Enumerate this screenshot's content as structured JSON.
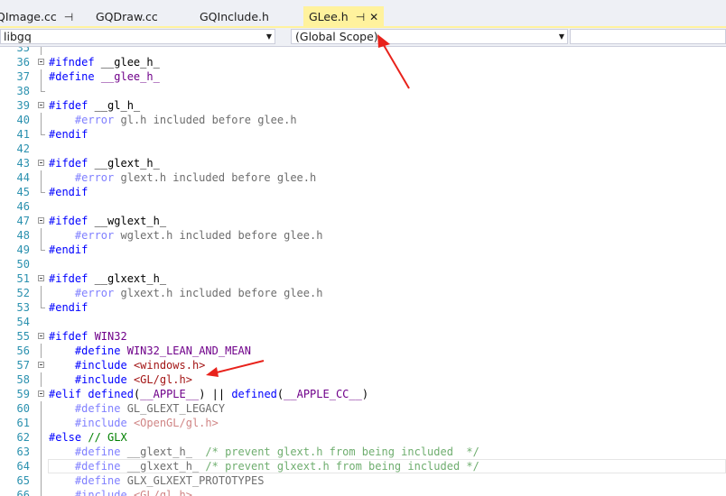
{
  "tabs": [
    {
      "label": "QImage.cc",
      "pinned": true,
      "active": false
    },
    {
      "label": "GQDraw.cc",
      "pinned": false,
      "active": false
    },
    {
      "label": "GQInclude.h",
      "pinned": false,
      "active": false
    },
    {
      "label": "GLee.h",
      "pinned": true,
      "active": true
    }
  ],
  "nav": {
    "project": "libgq",
    "scope": "(Global Scope)",
    "member": ""
  },
  "colors": {
    "active_tab": "#fff29d",
    "line_number": "#2b91af",
    "keyword": "#0000ff",
    "macro": "#6f008a",
    "string": "#a31515",
    "comment": "#008000",
    "annotation_arrow": "#e8221b"
  },
  "icons": {
    "pin": "pin-icon",
    "close": "close-icon",
    "dropdown": "chevron-down-icon",
    "fold": "collapse-box-icon"
  },
  "editor": {
    "lines": [
      {
        "n": "35",
        "fold": "line",
        "segs": []
      },
      {
        "n": "36",
        "fold": "box",
        "segs": [
          [
            "#ifndef",
            "kw"
          ],
          [
            " __glee_h_",
            "txt"
          ]
        ]
      },
      {
        "n": "37",
        "fold": "line",
        "segs": [
          [
            "#define",
            "kw"
          ],
          [
            " ",
            "txt"
          ],
          [
            "__glee_h_",
            "mac"
          ]
        ]
      },
      {
        "n": "38",
        "fold": "end",
        "segs": []
      },
      {
        "n": "39",
        "fold": "box",
        "segs": [
          [
            "#ifdef",
            "kw"
          ],
          [
            " __gl_h_",
            "txt"
          ]
        ]
      },
      {
        "n": "40",
        "fold": "line",
        "segs": [
          [
            "    ",
            "txt"
          ],
          [
            "#error",
            "dkw"
          ],
          [
            " gl.h included before glee.h",
            "dtxt"
          ]
        ]
      },
      {
        "n": "41",
        "fold": "end",
        "segs": [
          [
            "#endif",
            "kw"
          ]
        ]
      },
      {
        "n": "42",
        "fold": "none",
        "segs": []
      },
      {
        "n": "43",
        "fold": "box",
        "segs": [
          [
            "#ifdef",
            "kw"
          ],
          [
            " __glext_h_",
            "txt"
          ]
        ]
      },
      {
        "n": "44",
        "fold": "line",
        "segs": [
          [
            "    ",
            "txt"
          ],
          [
            "#error",
            "dkw"
          ],
          [
            " glext.h included before glee.h",
            "dtxt"
          ]
        ]
      },
      {
        "n": "45",
        "fold": "end",
        "segs": [
          [
            "#endif",
            "kw"
          ]
        ]
      },
      {
        "n": "46",
        "fold": "none",
        "segs": []
      },
      {
        "n": "47",
        "fold": "box",
        "segs": [
          [
            "#ifdef",
            "kw"
          ],
          [
            " __wglext_h_",
            "txt"
          ]
        ]
      },
      {
        "n": "48",
        "fold": "line",
        "segs": [
          [
            "    ",
            "txt"
          ],
          [
            "#error",
            "dkw"
          ],
          [
            " wglext.h included before glee.h",
            "dtxt"
          ]
        ]
      },
      {
        "n": "49",
        "fold": "end",
        "segs": [
          [
            "#endif",
            "kw"
          ]
        ]
      },
      {
        "n": "50",
        "fold": "none",
        "segs": []
      },
      {
        "n": "51",
        "fold": "box",
        "segs": [
          [
            "#ifdef",
            "kw"
          ],
          [
            " __glxext_h_",
            "txt"
          ]
        ]
      },
      {
        "n": "52",
        "fold": "line",
        "segs": [
          [
            "    ",
            "txt"
          ],
          [
            "#error",
            "dkw"
          ],
          [
            " glxext.h included before glee.h",
            "dtxt"
          ]
        ]
      },
      {
        "n": "53",
        "fold": "end",
        "segs": [
          [
            "#endif",
            "kw"
          ]
        ]
      },
      {
        "n": "54",
        "fold": "none",
        "segs": []
      },
      {
        "n": "55",
        "fold": "box",
        "segs": [
          [
            "#ifdef",
            "kw"
          ],
          [
            " WIN32",
            "mac"
          ]
        ]
      },
      {
        "n": "56",
        "fold": "line",
        "segs": [
          [
            "    ",
            "txt"
          ],
          [
            "#define",
            "kw"
          ],
          [
            " ",
            "txt"
          ],
          [
            "WIN32_LEAN_AND_MEAN",
            "mac"
          ]
        ]
      },
      {
        "n": "57",
        "fold": "box",
        "segs": [
          [
            "    ",
            "txt"
          ],
          [
            "#include",
            "kw"
          ],
          [
            " ",
            "txt"
          ],
          [
            "<windows.h>",
            "str"
          ]
        ]
      },
      {
        "n": "58",
        "fold": "line",
        "segs": [
          [
            "    ",
            "txt"
          ],
          [
            "#include",
            "kw"
          ],
          [
            " ",
            "txt"
          ],
          [
            "<GL/gl.h>",
            "str"
          ]
        ]
      },
      {
        "n": "59",
        "fold": "box",
        "segs": [
          [
            "#elif",
            "kw"
          ],
          [
            " ",
            "txt"
          ],
          [
            "defined",
            "kw"
          ],
          [
            "(",
            "txt"
          ],
          [
            "__APPLE__",
            "mac"
          ],
          [
            ") || ",
            "txt"
          ],
          [
            "defined",
            "kw"
          ],
          [
            "(",
            "txt"
          ],
          [
            "__APPLE_CC__",
            "mac"
          ],
          [
            ")",
            "txt"
          ]
        ]
      },
      {
        "n": "60",
        "fold": "line",
        "segs": [
          [
            "    ",
            "txt"
          ],
          [
            "#define",
            "dkw"
          ],
          [
            " GL_GLEXT_LEGACY",
            "dtxt"
          ]
        ]
      },
      {
        "n": "61",
        "fold": "line",
        "segs": [
          [
            "    ",
            "txt"
          ],
          [
            "#include",
            "dkw"
          ],
          [
            " ",
            "txt"
          ],
          [
            "<OpenGL/gl.h>",
            "dstr"
          ]
        ]
      },
      {
        "n": "62",
        "fold": "line",
        "segs": [
          [
            "#else",
            "kw"
          ],
          [
            " ",
            "txt"
          ],
          [
            "// GLX",
            "com"
          ]
        ]
      },
      {
        "n": "63",
        "fold": "line",
        "segs": [
          [
            "    ",
            "txt"
          ],
          [
            "#define",
            "dkw"
          ],
          [
            " __glext_h_  ",
            "dtxt"
          ],
          [
            "/* prevent glext.h from being included  */",
            "dcom"
          ]
        ]
      },
      {
        "n": "64",
        "fold": "line",
        "current": true,
        "segs": [
          [
            "    ",
            "txt"
          ],
          [
            "#define",
            "dkw"
          ],
          [
            " __glxext_h_ ",
            "dtxt"
          ],
          [
            "/* prevent glxext.h from being included */",
            "dcom"
          ]
        ]
      },
      {
        "n": "65",
        "fold": "line",
        "segs": [
          [
            "    ",
            "txt"
          ],
          [
            "#define",
            "dkw"
          ],
          [
            " GLX_GLXEXT_PROTOTYPES",
            "dtxt"
          ]
        ]
      },
      {
        "n": "66",
        "fold": "line",
        "segs": [
          [
            "    ",
            "txt"
          ],
          [
            "#include",
            "dkw"
          ],
          [
            " ",
            "txt"
          ],
          [
            "<GL/gl.h>",
            "dstr"
          ]
        ]
      }
    ]
  }
}
